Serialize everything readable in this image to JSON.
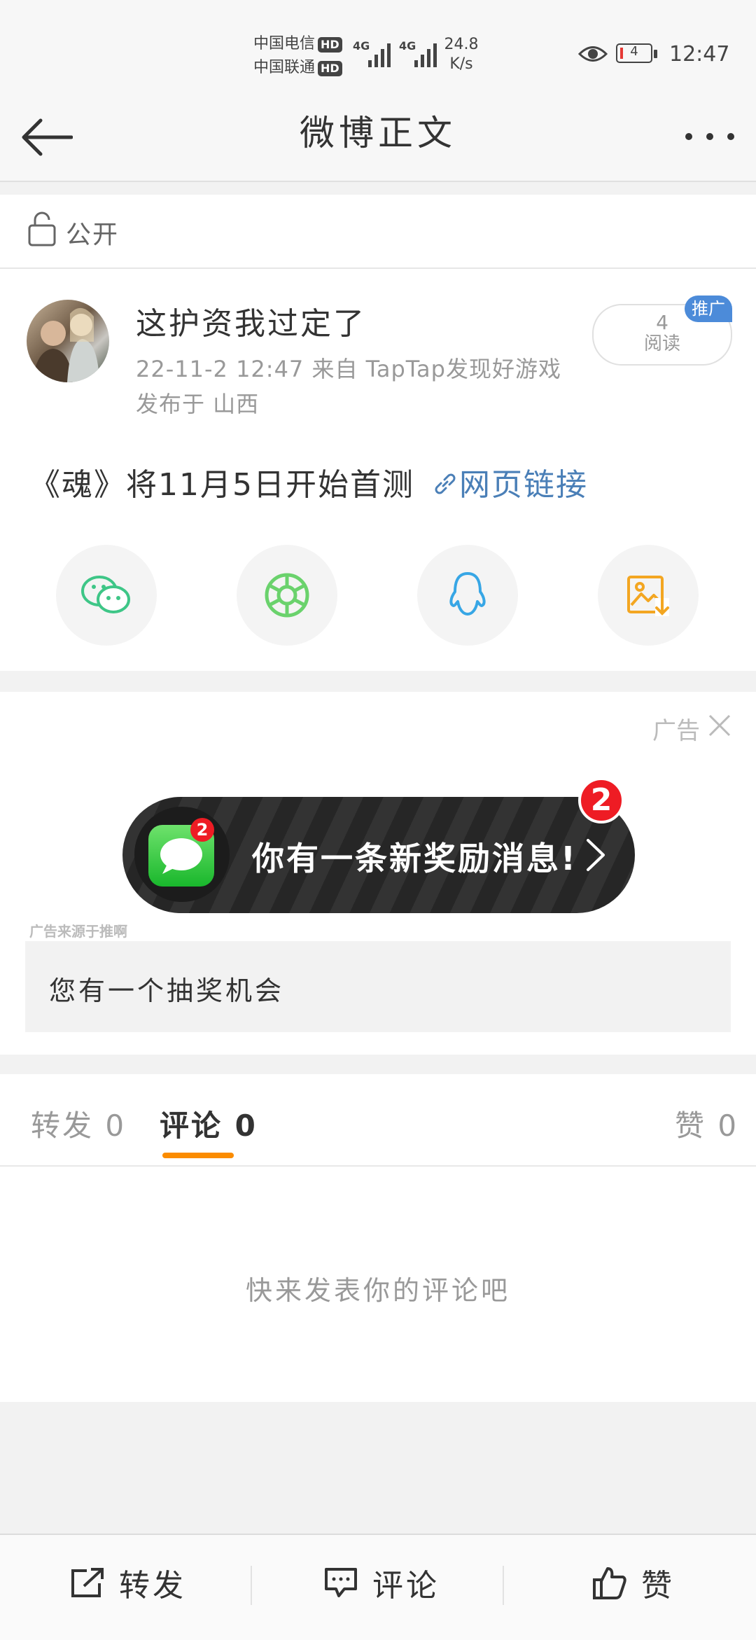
{
  "status_bar": {
    "carrier_1": "中国电信",
    "carrier_2": "中国联通",
    "hd": "HD",
    "network_1": "4G",
    "network_2": "4G",
    "speed_value": "24.8",
    "speed_unit": "K/s",
    "battery": "4",
    "time": "12:47"
  },
  "nav": {
    "title": "微博正文"
  },
  "visibility": {
    "label": "公开"
  },
  "post": {
    "username": "这护资我过定了",
    "meta_line": "22-11-2 12:47  来自 TapTap发现好游戏",
    "location": "发布于 山西",
    "read_count": "4",
    "read_label": "阅读",
    "promo_tag": "推广",
    "text": "《魂》将11月5日开始首测",
    "link_text": "网页链接"
  },
  "share_icons": [
    "wechat-icon",
    "moments-icon",
    "qq-icon",
    "save-image-icon"
  ],
  "ad": {
    "label": "广告",
    "banner_text": "你有一条新奖励消息!",
    "badge_count": "2",
    "icon_badge": "2",
    "source": "广告来源于推啊",
    "description": "您有一个抽奖机会"
  },
  "tabs": {
    "repost": "转发 0",
    "comment": "评论 0",
    "like": "赞 0"
  },
  "comments": {
    "empty": "快来发表你的评论吧"
  },
  "bottom_bar": {
    "repost": "转发",
    "comment": "评论",
    "like": "赞"
  },
  "colors": {
    "accent": "#fb8c00",
    "link": "#4a7fb7",
    "promo": "#4c8bd9",
    "wechat": "#3ec687",
    "moments": "#6ad26c",
    "qq": "#37a6e5",
    "save": "#f3a621"
  }
}
